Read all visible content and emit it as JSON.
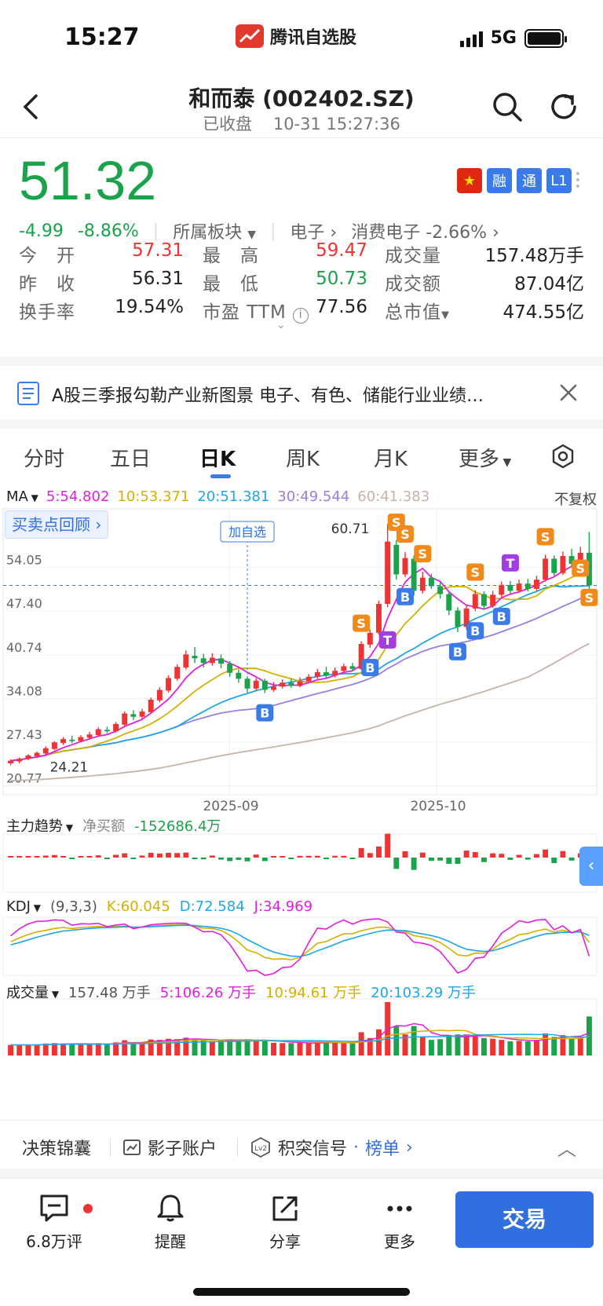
{
  "status": {
    "time": "15:27",
    "app_name": "腾讯自选股",
    "network": "5G"
  },
  "nav": {
    "title": "和而泰 (002402.SZ)",
    "status": "已收盘",
    "datetime": "10-31 15:27:36"
  },
  "quote": {
    "price": "51.32",
    "change": "-4.99",
    "change_pct": "-8.86%",
    "sector_label": "所属板块",
    "sector_1": "电子",
    "sector_2": "消费电子 -2.66%",
    "badges": [
      "融",
      "通",
      "L1"
    ],
    "colors": {
      "down": "#1aa34a",
      "up": "#ee3333",
      "accent": "#2f6fe0"
    }
  },
  "stats": {
    "open_label": "今　开",
    "open": "57.31",
    "high_label": "最　高",
    "high": "59.47",
    "volume_label": "成交量",
    "volume": "157.48万手",
    "prev_label": "昨　收",
    "prev": "56.31",
    "low_label": "最　低",
    "low": "50.73",
    "amount_label": "成交额",
    "amount": "87.04亿",
    "turnover_label": "换手率",
    "turnover": "19.54%",
    "pe_label": "市盈 TTM",
    "pe": "77.56",
    "mcap_label": "总市值",
    "mcap": "474.55亿"
  },
  "news": {
    "text": "A股三季报勾勒产业新图景 电子、有色、储能行业业绩…"
  },
  "tabs": [
    "分时",
    "五日",
    "日K",
    "周K",
    "月K",
    "更多"
  ],
  "ma": {
    "label": "MA",
    "ma5": "5:54.802",
    "ma10": "10:53.371",
    "ma20": "20:51.381",
    "ma30": "30:49.544",
    "ma60": "60:41.383",
    "adjust": "不复权",
    "colors": {
      "ma5": "#e020e0",
      "ma10": "#d4b000",
      "ma20": "#1ea6e8",
      "ma30": "#9a7fe0",
      "ma60": "#c9b2a8"
    }
  },
  "buysell_review": "买卖点回顾",
  "add_watch": "加自选",
  "max_label": "60.71",
  "min_label": "24.21",
  "y_ticks": [
    "54.05",
    "47.40",
    "40.74",
    "34.08",
    "27.43",
    "20.77"
  ],
  "x_ticks": [
    "2025-09",
    "2025-10"
  ],
  "flow": {
    "label": "主力趋势",
    "net_label": "净买额",
    "net_value": "-152686.4万"
  },
  "kdj": {
    "label": "KDJ",
    "params": "(9,3,3)",
    "k": "K:60.045",
    "d": "D:72.584",
    "j": "J:34.969"
  },
  "volume": {
    "label": "成交量",
    "total": "157.48 万手",
    "v5": "5:106.26 万手",
    "v10": "10:94.61 万手",
    "v20": "20:103.29 万手"
  },
  "bottom_strip": {
    "item1": "决策锦囊",
    "item2": "影子账户",
    "item3": "积突信号",
    "item3_link": "榜单"
  },
  "toolbar": {
    "comments": "6.8万评",
    "alert": "提醒",
    "share": "分享",
    "more": "更多",
    "trade": "交易"
  },
  "chart_data": {
    "type": "candlestick",
    "price_range": [
      20.77,
      60.71
    ],
    "candles": [
      [
        24.2,
        24.6,
        23.9,
        24.8
      ],
      [
        24.5,
        24.9,
        24.2,
        25.1
      ],
      [
        24.9,
        25.4,
        24.7,
        25.6
      ],
      [
        25.3,
        25.8,
        25.0,
        26.0
      ],
      [
        25.7,
        26.5,
        25.5,
        26.8
      ],
      [
        26.4,
        27.4,
        26.2,
        27.6
      ],
      [
        27.3,
        27.9,
        27.0,
        28.2
      ],
      [
        27.8,
        27.6,
        27.3,
        28.4
      ],
      [
        27.6,
        28.2,
        27.4,
        28.5
      ],
      [
        28.1,
        28.6,
        27.8,
        29.0
      ],
      [
        28.5,
        29.4,
        28.3,
        29.7
      ],
      [
        29.3,
        29.1,
        28.8,
        29.8
      ],
      [
        29.1,
        30.2,
        28.9,
        30.5
      ],
      [
        30.1,
        31.8,
        29.9,
        32.1
      ],
      [
        31.7,
        31.3,
        30.8,
        32.3
      ],
      [
        31.3,
        32.1,
        31.0,
        32.5
      ],
      [
        32.0,
        33.9,
        31.8,
        34.2
      ],
      [
        33.8,
        35.4,
        33.5,
        35.8
      ],
      [
        35.3,
        37.2,
        35.0,
        37.6
      ],
      [
        37.1,
        38.9,
        36.8,
        39.3
      ],
      [
        38.8,
        40.8,
        38.5,
        41.4
      ],
      [
        40.6,
        40.2,
        39.5,
        41.9
      ],
      [
        40.2,
        39.5,
        38.8,
        40.9
      ],
      [
        39.5,
        40.3,
        39.1,
        41.0
      ],
      [
        40.2,
        39.4,
        38.7,
        40.8
      ],
      [
        39.4,
        38.0,
        37.4,
        39.8
      ],
      [
        38.0,
        37.1,
        36.5,
        38.5
      ],
      [
        37.1,
        35.6,
        35.0,
        37.5
      ],
      [
        35.6,
        36.8,
        35.3,
        37.2
      ],
      [
        36.8,
        35.4,
        34.9,
        37.1
      ],
      [
        35.4,
        35.9,
        35.1,
        36.6
      ],
      [
        35.9,
        36.5,
        35.6,
        37.0
      ],
      [
        36.5,
        36.0,
        35.7,
        37.1
      ],
      [
        36.0,
        36.7,
        35.8,
        37.3
      ],
      [
        36.7,
        37.4,
        36.4,
        37.8
      ],
      [
        37.4,
        38.1,
        37.1,
        38.6
      ],
      [
        38.1,
        37.6,
        37.2,
        38.9
      ],
      [
        37.6,
        38.3,
        37.3,
        38.8
      ],
      [
        38.3,
        39.0,
        38.0,
        39.4
      ],
      [
        39.0,
        38.6,
        38.2,
        39.5
      ],
      [
        38.6,
        42.4,
        38.4,
        42.8
      ],
      [
        42.3,
        44.1,
        41.8,
        44.6
      ],
      [
        44.1,
        48.5,
        43.8,
        49.0
      ],
      [
        48.5,
        58.0,
        48.0,
        60.7
      ],
      [
        57.5,
        53.0,
        52.2,
        58.2
      ],
      [
        53.0,
        55.5,
        52.6,
        56.4
      ],
      [
        55.4,
        50.5,
        49.8,
        55.9
      ],
      [
        50.5,
        52.5,
        50.1,
        53.4
      ],
      [
        52.5,
        51.2,
        50.8,
        53.1
      ],
      [
        51.2,
        50.0,
        49.3,
        51.8
      ],
      [
        50.0,
        47.5,
        46.8,
        50.3
      ],
      [
        47.5,
        45.0,
        44.2,
        48.0
      ],
      [
        45.0,
        47.8,
        44.6,
        48.4
      ],
      [
        47.8,
        50.0,
        47.4,
        50.6
      ],
      [
        50.0,
        48.2,
        47.6,
        50.4
      ],
      [
        48.2,
        49.9,
        47.9,
        50.5
      ],
      [
        49.9,
        51.4,
        49.6,
        51.9
      ],
      [
        51.4,
        50.5,
        50.1,
        52.0
      ],
      [
        50.5,
        51.6,
        50.2,
        52.2
      ],
      [
        51.6,
        50.8,
        50.4,
        52.3
      ],
      [
        50.8,
        52.2,
        50.5,
        52.8
      ],
      [
        52.2,
        55.4,
        51.9,
        56.0
      ],
      [
        55.4,
        53.2,
        52.8,
        55.9
      ],
      [
        53.2,
        55.8,
        52.9,
        56.5
      ],
      [
        55.8,
        54.6,
        54.2,
        56.9
      ],
      [
        54.6,
        56.3,
        54.2,
        57.2
      ],
      [
        56.31,
        51.32,
        50.73,
        59.47
      ]
    ],
    "ma_series": [
      "MA5",
      "MA10",
      "MA20",
      "MA30",
      "MA60"
    ]
  }
}
